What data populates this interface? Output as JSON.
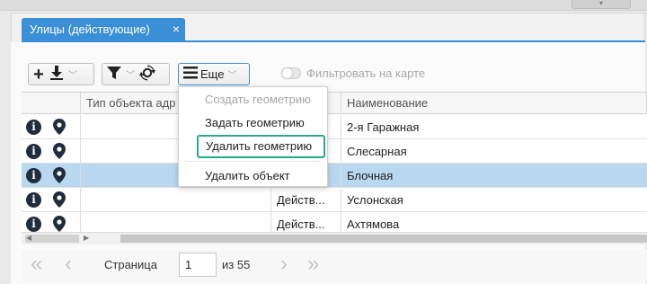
{
  "tab": {
    "title": "Улицы (действующие)",
    "close": "×"
  },
  "toolbar": {
    "more_label": "Еще",
    "map_filter_label": "Фильтровать на карте"
  },
  "grid": {
    "columns": [
      "Тип объекта адр",
      "Наименование"
    ],
    "rows": [
      {
        "type": "",
        "state": "",
        "name": "2-я Гаражная",
        "selected": false
      },
      {
        "type": "",
        "state": "",
        "name": "Слесарная",
        "selected": false
      },
      {
        "type": "",
        "state": "",
        "name": "Блочная",
        "selected": true
      },
      {
        "type": "",
        "state": "Действ...",
        "name": "Услонская",
        "selected": false
      },
      {
        "type": "",
        "state": "Действ...",
        "name": "Ахтямова",
        "selected": false
      }
    ]
  },
  "menu": {
    "items": [
      {
        "label": "Создать геометрию",
        "disabled": true
      },
      {
        "label": "Задать геометрию",
        "disabled": false
      },
      {
        "label": "Удалить геометрию",
        "disabled": false,
        "highlighted": true
      },
      {
        "label": "Удалить объект",
        "disabled": false
      }
    ]
  },
  "pager": {
    "page_label": "Страница",
    "page_value": "1",
    "of_label": "из 55"
  },
  "icons": {
    "info": "info-icon",
    "pin": "map-pin-icon",
    "add": "plus-icon",
    "download": "download-icon",
    "filter": "filter-icon",
    "refresh": "refresh-icon",
    "menu": "hamburger-icon"
  },
  "colors": {
    "accent": "#3a8fd6",
    "selected_row": "#b9d7ef",
    "highlight_border": "#27a88f"
  }
}
